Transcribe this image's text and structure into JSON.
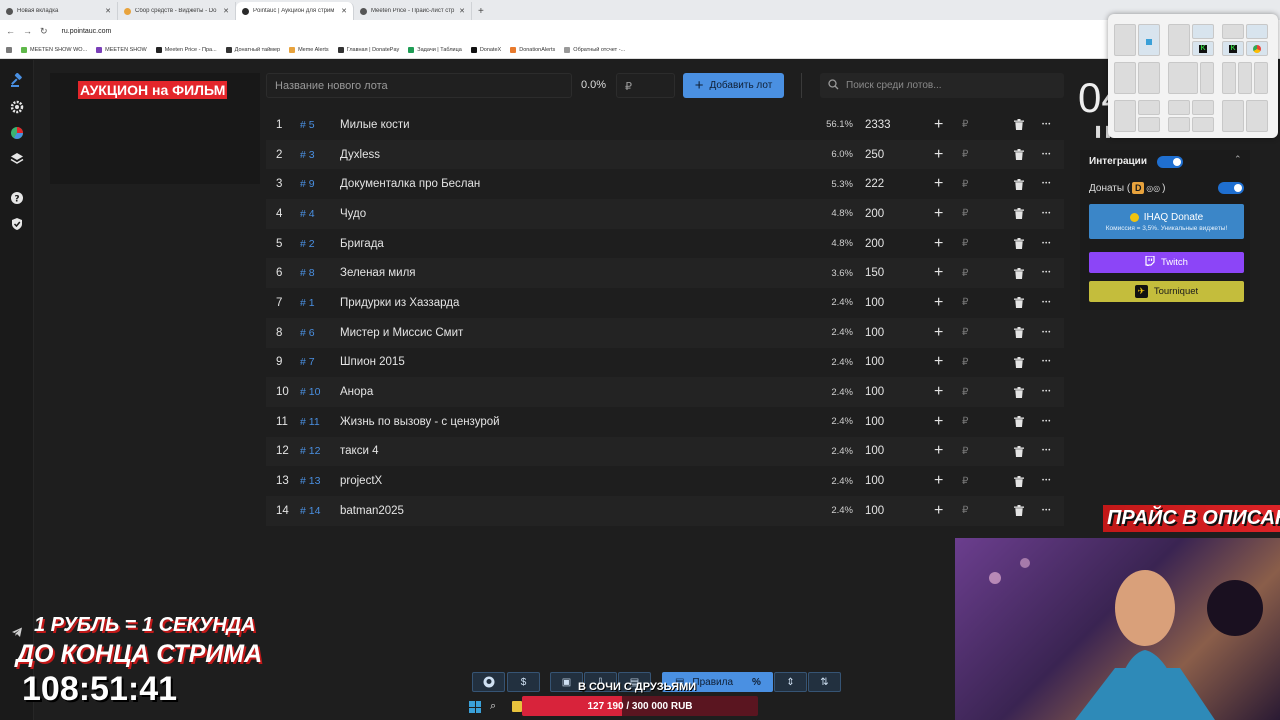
{
  "browser": {
    "tabs": [
      {
        "label": "Новая вкладка",
        "active": false
      },
      {
        "label": "Сбор средств - Виджеты - Do",
        "active": false
      },
      {
        "label": "Pointauc | Аукцион для стрим",
        "active": true
      },
      {
        "label": "Meeten Price - Прайс-лист стр",
        "active": false
      }
    ],
    "url": "ru.pointauc.com",
    "bookmarks": [
      "MEETEN SHOW WO...",
      "MEETEN SHOW",
      "Meeten Price - Пра...",
      "Донатный таймер",
      "Meme Alerts",
      "Главная | DonatePay",
      "Задачи | Таблица",
      "DonateX",
      "DonationAlerts",
      "Обратный отсчет -..."
    ]
  },
  "sidebar": {
    "icons": [
      "gavel-icon",
      "gear-icon",
      "pie-chart-icon",
      "layers-icon",
      "help-icon",
      "shield-icon"
    ]
  },
  "auction": {
    "title": "АУКЦИОН на ФИЛЬМ"
  },
  "controls": {
    "new_lot_placeholder": "Название нового лота",
    "percent": "0.0%",
    "currency_placeholder": "₽",
    "add_lot_label": "Добавить лот",
    "search_placeholder": "Поиск среди лотов..."
  },
  "lots": [
    {
      "num": "1",
      "id": "# 5",
      "name": "Милые кости",
      "pct": "56.1%",
      "amount": "2333"
    },
    {
      "num": "2",
      "id": "# 3",
      "name": "Дуxless",
      "pct": "6.0%",
      "amount": "250"
    },
    {
      "num": "3",
      "id": "# 9",
      "name": "Документалка про Беслан",
      "pct": "5.3%",
      "amount": "222"
    },
    {
      "num": "4",
      "id": "# 4",
      "name": "Чудо",
      "pct": "4.8%",
      "amount": "200"
    },
    {
      "num": "5",
      "id": "# 2",
      "name": "Бригада",
      "pct": "4.8%",
      "amount": "200"
    },
    {
      "num": "6",
      "id": "# 8",
      "name": "Зеленая миля",
      "pct": "3.6%",
      "amount": "150"
    },
    {
      "num": "7",
      "id": "# 1",
      "name": "Придурки из Хаззарда",
      "pct": "2.4%",
      "amount": "100"
    },
    {
      "num": "8",
      "id": "# 6",
      "name": "Мистер и Миссис Смит",
      "pct": "2.4%",
      "amount": "100"
    },
    {
      "num": "9",
      "id": "# 7",
      "name": "Шпион 2015",
      "pct": "2.4%",
      "amount": "100"
    },
    {
      "num": "10",
      "id": "# 10",
      "name": "Анора",
      "pct": "2.4%",
      "amount": "100"
    },
    {
      "num": "11",
      "id": "# 11",
      "name": "Жизнь по вызову - с цензурой",
      "pct": "2.4%",
      "amount": "100"
    },
    {
      "num": "12",
      "id": "# 12",
      "name": "такси 4",
      "pct": "2.4%",
      "amount": "100"
    },
    {
      "num": "13",
      "id": "# 13",
      "name": "projectX",
      "pct": "2.4%",
      "amount": "100"
    },
    {
      "num": "14",
      "id": "# 14",
      "name": "batman2025",
      "pct": "2.4%",
      "amount": "100"
    }
  ],
  "lot_currency": "₽",
  "right_panel": {
    "timer": "04",
    "integrations_label": "Интеграции",
    "donations_label": "Донаты (",
    "donations_suffix": ")",
    "ihaq_label": "IHAQ Donate",
    "ihaq_sub": "Комиссия = 3,5%. Уникальные виджеты!",
    "twitch_label": "Twitch",
    "tourniquet_label": "Tourniquet"
  },
  "bottom_toolbar": {
    "rules_label": "Правила",
    "percent_label": "%"
  },
  "stream_overlay": {
    "ruble_line": "1 РУБЛЬ = 1 СЕКУНДА",
    "end_line": "ДО КОНЦА СТРИМА",
    "countdown": "108:51:41",
    "price_banner": "ПРАЙС В ОПИСАНИИ",
    "goal_title": "В СОЧИ С ДРУЗЬЯМИ",
    "goal_text": "127 190 / 300 000 RUB",
    "goal_progress": 0.424
  },
  "colors": {
    "accent": "#4a90e2",
    "auction_red": "#e3262b",
    "twitch": "#8c45f7",
    "tourniquet": "#c4bd3c",
    "ihaq": "#3b86c8"
  }
}
